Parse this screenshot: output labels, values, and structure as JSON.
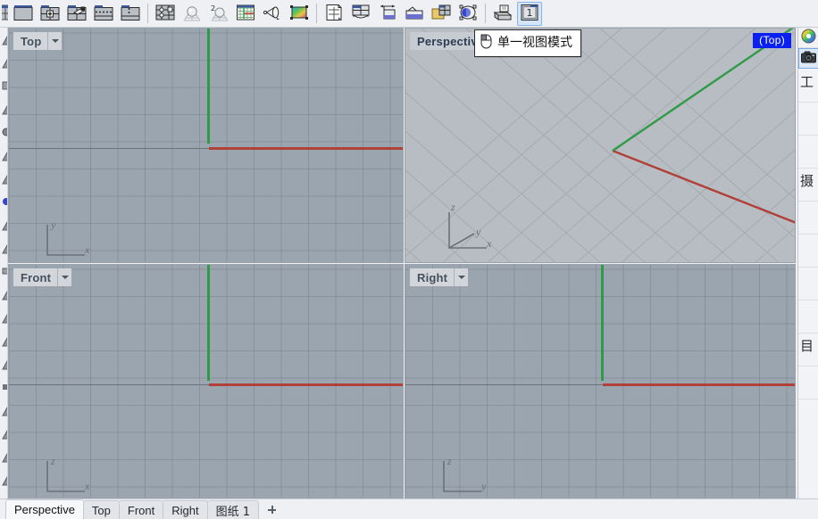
{
  "toolbar": {
    "name": "main-toolbar",
    "buttons": [
      {
        "name": "viewport-layout-partial-icon",
        "title": ""
      },
      {
        "name": "viewport-single-icon",
        "title": ""
      },
      {
        "name": "viewport-four-split-icon",
        "title": ""
      },
      {
        "name": "viewport-split-drag-icon",
        "title": ""
      },
      {
        "name": "viewport-horizontal-split-icon",
        "title": ""
      },
      {
        "name": "viewport-vertical-split-icon",
        "title": ""
      },
      {
        "name": "viewport-properties-icon",
        "title": ""
      },
      {
        "name": "shaded-sphere-icon",
        "title": ""
      },
      {
        "name": "rendered-sphere-icon",
        "title": ""
      },
      {
        "name": "grid-settings-icon",
        "title": ""
      },
      {
        "name": "camera-lens-icon",
        "title": ""
      },
      {
        "name": "render-preview-icon",
        "title": ""
      },
      {
        "name": "new-layout-page-icon",
        "title": ""
      },
      {
        "name": "detail-four-view-icon",
        "title": ""
      },
      {
        "name": "detail-scale-icon",
        "title": ""
      },
      {
        "name": "detail-insert-icon",
        "title": ""
      },
      {
        "name": "detail-folder-icon",
        "title": ""
      },
      {
        "name": "detail-rotate-icon",
        "title": ""
      },
      {
        "name": "print-icon",
        "title": ""
      },
      {
        "name": "single-view-mode-icon",
        "title": "单一视图模式"
      }
    ]
  },
  "tooltip": {
    "text": "单一视图模式",
    "icon": "mouse-icon"
  },
  "viewports": {
    "top": {
      "label": "Top",
      "axes": [
        "y",
        "x"
      ]
    },
    "perspective": {
      "label": "Perspective",
      "named_view": "(Top)",
      "axes": [
        "z",
        "y",
        "x"
      ]
    },
    "front": {
      "label": "Front",
      "axes": [
        "z",
        "x"
      ]
    },
    "right": {
      "label": "Right",
      "axes": [
        "z",
        "y"
      ]
    },
    "colors": {
      "ortho_background": "#9ba5b0",
      "perspective_background": "#b8bdc3",
      "grid_line": "#78828e",
      "x_axis": "#b04038",
      "y_axis": "#2e9b47",
      "named_view_background": "#0a20f0",
      "named_view_text": "#ffffff"
    }
  },
  "right_panel": {
    "tabs": [
      {
        "name": "color-wheel-tab",
        "label": ""
      },
      {
        "name": "camera-tab",
        "label": ""
      }
    ],
    "rows": [
      {
        "label": "工"
      },
      {
        "label": ""
      },
      {
        "label": ""
      },
      {
        "label": "摄"
      },
      {
        "label": ""
      },
      {
        "label": ""
      },
      {
        "label": ""
      },
      {
        "label": ""
      },
      {
        "label": "目"
      },
      {
        "label": ""
      }
    ]
  },
  "bottom_tabs": {
    "items": [
      {
        "label": "Perspective",
        "active": true,
        "cjk": false
      },
      {
        "label": "Top",
        "active": false,
        "cjk": false
      },
      {
        "label": "Front",
        "active": false,
        "cjk": false
      },
      {
        "label": "Right",
        "active": false,
        "cjk": false
      },
      {
        "label": "图纸 1",
        "active": false,
        "cjk": true
      }
    ],
    "add_label": "+"
  }
}
